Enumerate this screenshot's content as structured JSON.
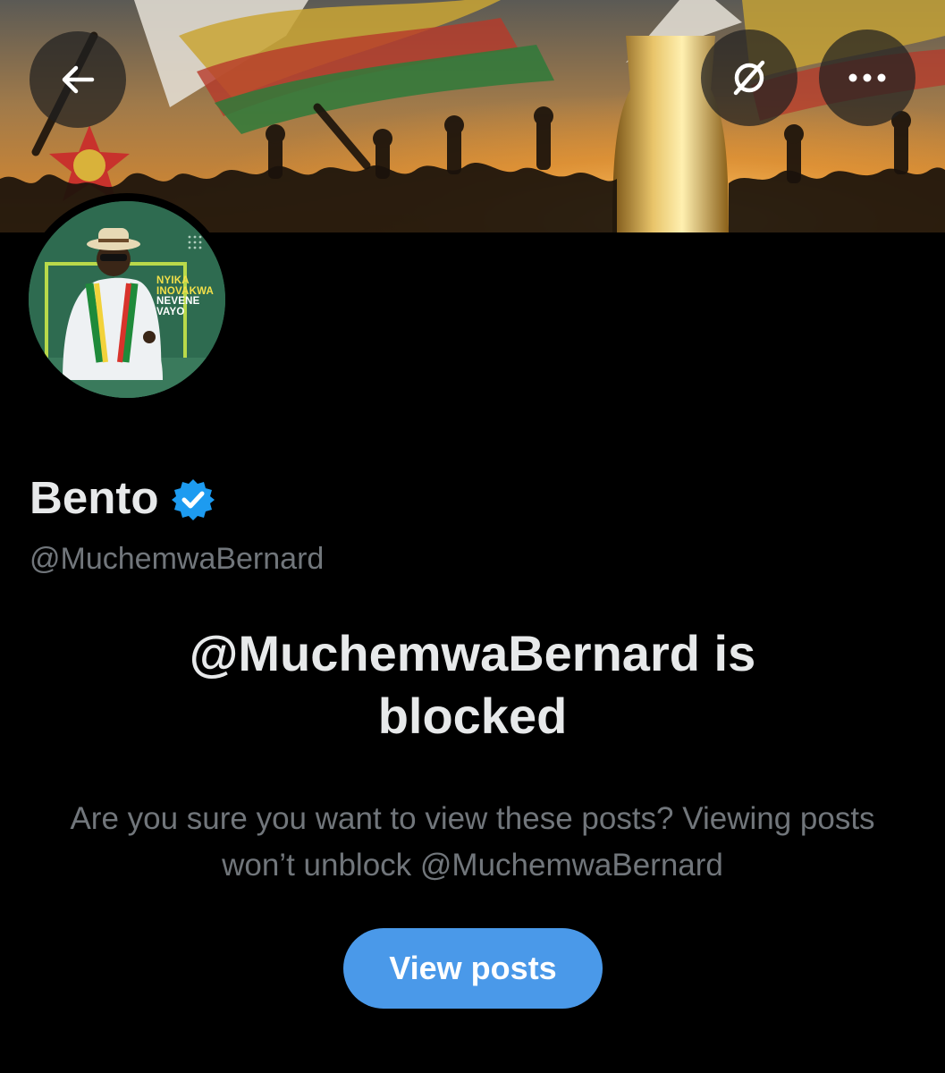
{
  "header": {
    "back_icon": "arrow-left-icon",
    "hide_icon": "eye-slash-icon",
    "more_icon": "more-horizontal-icon"
  },
  "avatar": {
    "poster_text": [
      "NYIKA",
      "INOVAKWA",
      "NEVENE",
      "VAYO"
    ]
  },
  "profile": {
    "display_name": "Bento",
    "verified": true,
    "verified_color": "#1d9bf0",
    "handle": "@MuchemwaBernard"
  },
  "blocked_notice": {
    "title": "@MuchemwaBernard is blocked",
    "message": "Are you sure you want to view these posts? Viewing posts won’t unblock @MuchemwaBernard",
    "button_label": "View posts",
    "button_color": "#4a99e9"
  }
}
